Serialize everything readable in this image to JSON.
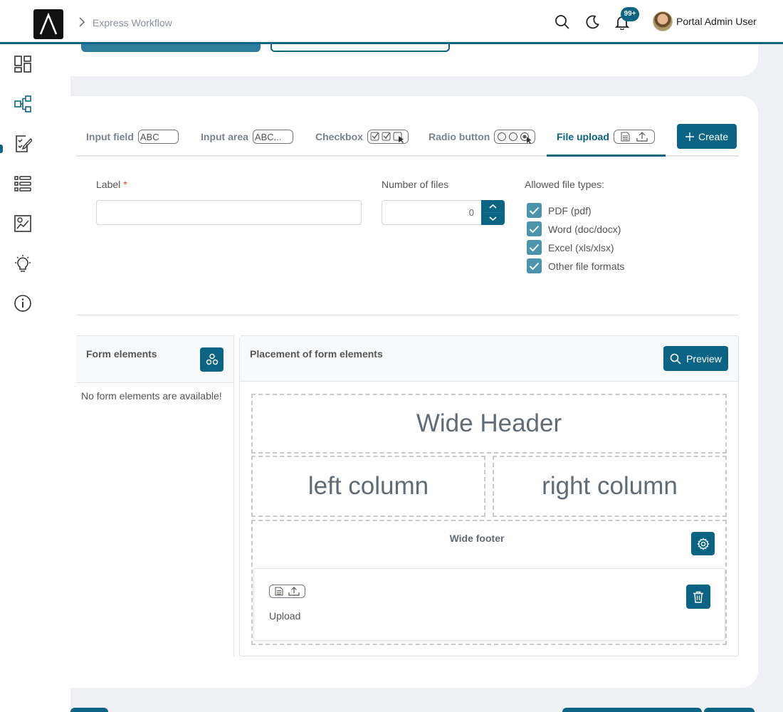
{
  "header": {
    "breadcrumb": "Express Workflow",
    "notification_count": "99+",
    "user_name": "Portal Admin User",
    "icons": [
      "search-icon",
      "moon-icon",
      "bell-icon"
    ]
  },
  "sidebar": {
    "items": [
      {
        "icon": "dashboard-icon"
      },
      {
        "icon": "workflow-icon",
        "active": true
      },
      {
        "icon": "task-checklist-icon"
      },
      {
        "icon": "list-icon"
      },
      {
        "icon": "statistics-icon"
      },
      {
        "icon": "lightbulb-icon"
      },
      {
        "icon": "info-icon"
      }
    ]
  },
  "tabs": [
    {
      "label": "Input field",
      "pill": "ABC"
    },
    {
      "label": "Input area",
      "pill": "ABC..."
    },
    {
      "label": "Checkbox",
      "pill": "checkbox-pill-icon"
    },
    {
      "label": "Radio button",
      "pill": "radio-pill-icon"
    },
    {
      "label": "File upload",
      "pill": "file-upload-pill-icon",
      "active": true
    }
  ],
  "create_button": "Create",
  "form": {
    "label_label": "Label",
    "label_required": "*",
    "label_value": "",
    "number_label": "Number of files",
    "number_value": "0",
    "file_types_label": "Allowed file types:",
    "file_types": [
      {
        "label": "PDF (pdf)",
        "checked": true
      },
      {
        "label": "Word (doc/docx)",
        "checked": true
      },
      {
        "label": "Excel (xls/xlsx)",
        "checked": true
      },
      {
        "label": "Other file formats",
        "checked": true
      }
    ]
  },
  "form_elements": {
    "title": "Form elements",
    "empty_text": "No form elements are available!"
  },
  "placement": {
    "title": "Placement of form elements",
    "preview_button": "Preview",
    "wide_header": "Wide Header",
    "left_column": "left column",
    "right_column": "right column",
    "wide_footer": "Wide footer",
    "upload_element_label": "Upload"
  },
  "colors": {
    "primary": "#0b6483",
    "checkbox": "#4a95ab",
    "background": "#eef0f3",
    "required": "#d83a3a"
  }
}
